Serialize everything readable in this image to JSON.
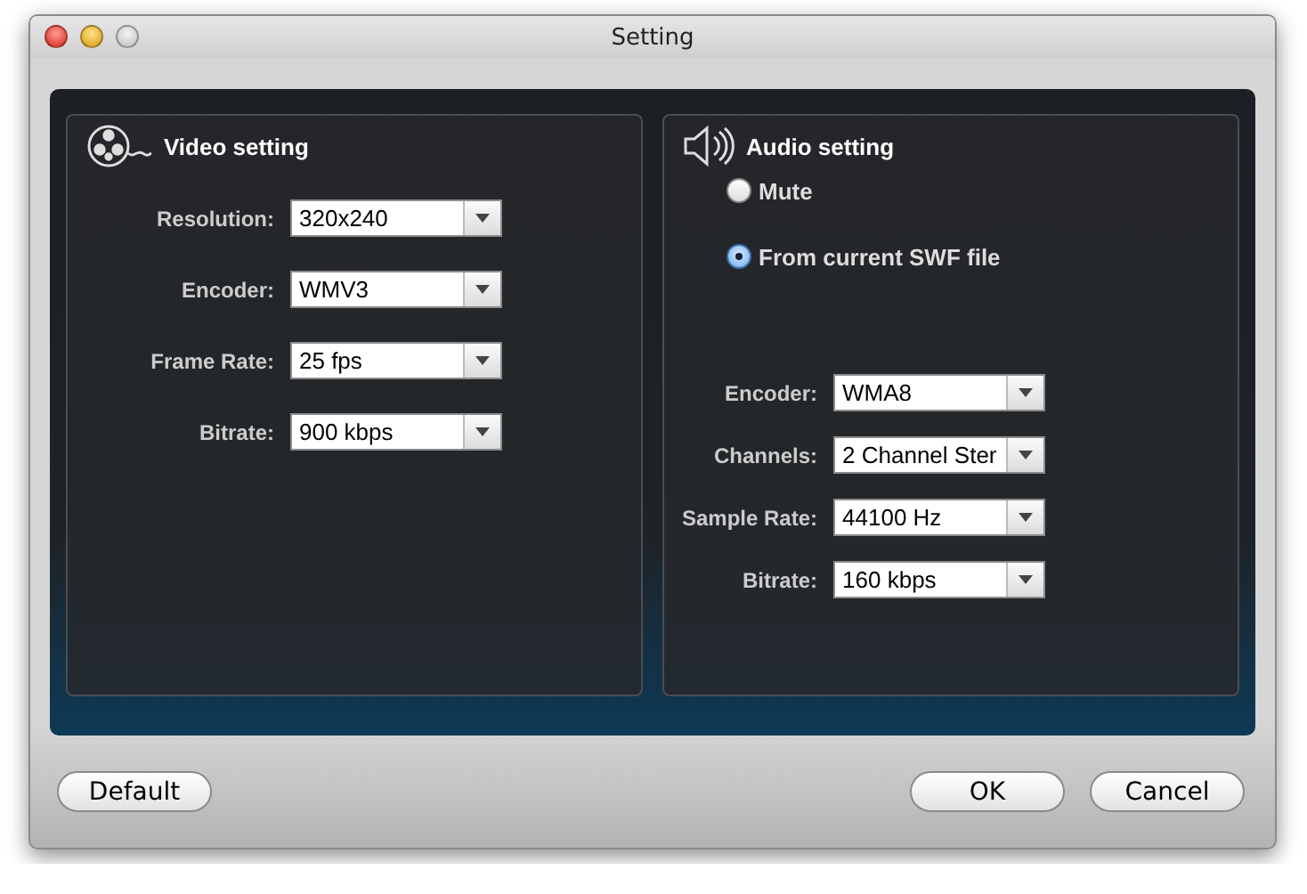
{
  "window": {
    "title": "Setting"
  },
  "video": {
    "title": "Video setting",
    "fields": [
      {
        "label": "Resolution:",
        "value": "320x240"
      },
      {
        "label": "Encoder:",
        "value": "WMV3"
      },
      {
        "label": "Frame Rate:",
        "value": "25 fps"
      },
      {
        "label": "Bitrate:",
        "value": "900 kbps"
      }
    ]
  },
  "audio": {
    "title": "Audio setting",
    "options": [
      {
        "label": "Mute",
        "selected": false
      },
      {
        "label": "From current SWF file",
        "selected": true
      }
    ],
    "fields": [
      {
        "label": "Encoder:",
        "value": "WMA8"
      },
      {
        "label": "Channels:",
        "value": "2 Channel Ster"
      },
      {
        "label": "Sample Rate:",
        "value": "44100 Hz"
      },
      {
        "label": "Bitrate:",
        "value": "160 kbps"
      }
    ]
  },
  "footer": {
    "left_buttons": [
      "Default"
    ],
    "right_buttons": [
      "OK",
      "Cancel"
    ]
  }
}
